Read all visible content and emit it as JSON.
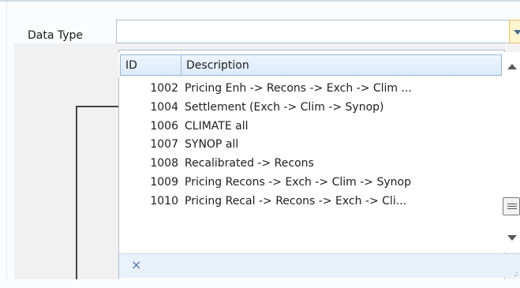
{
  "field": {
    "label": "Data Type",
    "value": ""
  },
  "grid": {
    "columns": {
      "id": "ID",
      "description": "Description"
    },
    "rows": [
      {
        "id": "1002",
        "description": "Pricing Enh -> Recons -> Exch -> Clim ..."
      },
      {
        "id": "1004",
        "description": "Settlement (Exch -> Clim -> Synop)"
      },
      {
        "id": "1006",
        "description": "CLIMATE all"
      },
      {
        "id": "1007",
        "description": "SYNOP all"
      },
      {
        "id": "1008",
        "description": "Recalibrated -> Recons"
      },
      {
        "id": "1009",
        "description": "Pricing Recons -> Exch -> Clim -> Synop"
      },
      {
        "id": "1010",
        "description": "Pricing Recal -> Recons -> Exch -> Cli..."
      }
    ]
  },
  "footer": {
    "clear_label": "×",
    "grip_label": ".:"
  }
}
